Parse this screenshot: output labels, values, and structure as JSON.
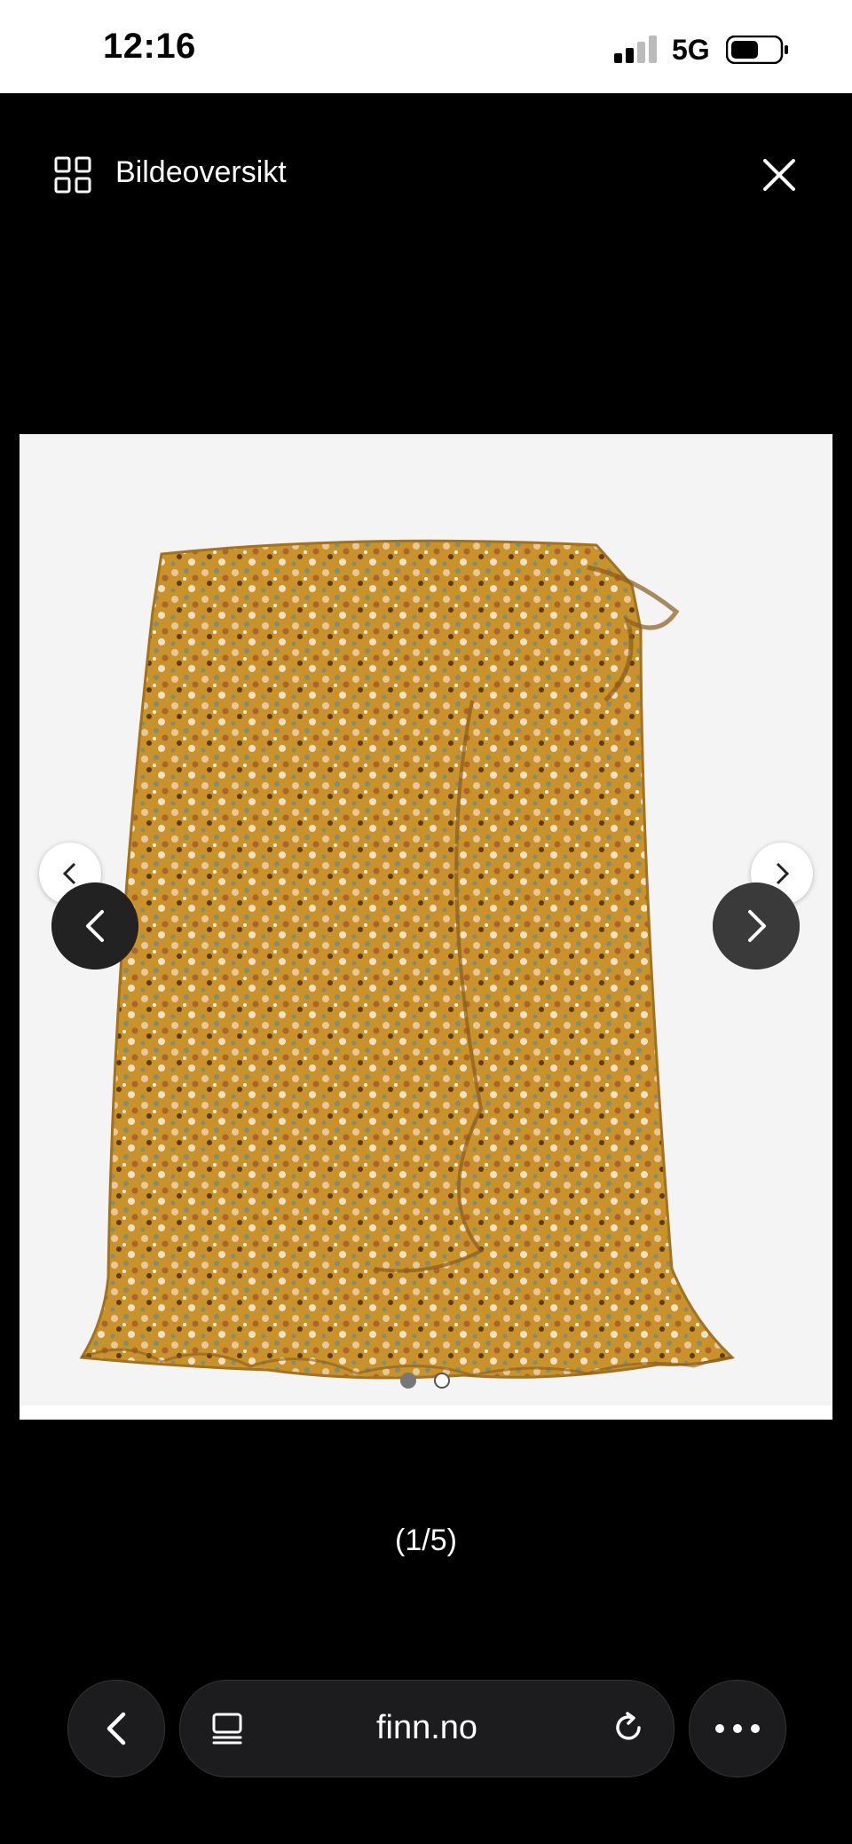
{
  "status": {
    "time": "12:16",
    "network": "5G"
  },
  "header": {
    "title": "Bildeoversikt"
  },
  "viewer": {
    "current_inner_image": 1,
    "inner_image_count": 2
  },
  "counter": {
    "text": "(1/5)"
  },
  "browser": {
    "url": "finn.no"
  },
  "colors": {
    "background": "#000000",
    "image_bg": "#f4f4f4",
    "skirt_base": "#c9922b"
  }
}
